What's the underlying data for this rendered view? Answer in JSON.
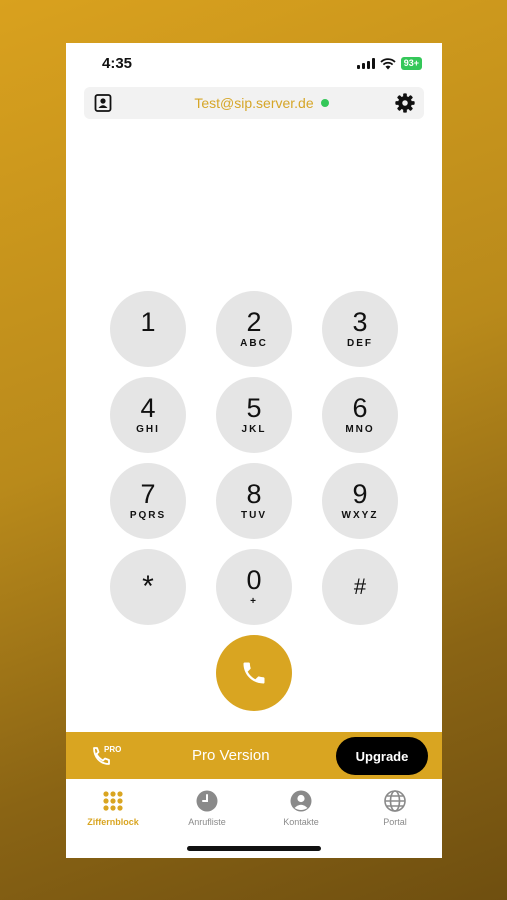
{
  "status_bar": {
    "time": "4:35",
    "battery": "93+"
  },
  "account": {
    "address": "Test@sip.server.de",
    "status_color": "#34c759"
  },
  "keypad": {
    "keys": [
      {
        "digit": "1",
        "letters": ""
      },
      {
        "digit": "2",
        "letters": "ABC"
      },
      {
        "digit": "3",
        "letters": "DEF"
      },
      {
        "digit": "4",
        "letters": "GHI"
      },
      {
        "digit": "5",
        "letters": "JKL"
      },
      {
        "digit": "6",
        "letters": "MNO"
      },
      {
        "digit": "7",
        "letters": "PQRS"
      },
      {
        "digit": "8",
        "letters": "TUV"
      },
      {
        "digit": "9",
        "letters": "WXYZ"
      },
      {
        "digit": "*",
        "letters": ""
      },
      {
        "digit": "0",
        "letters": "+"
      },
      {
        "digit": "#",
        "letters": ""
      }
    ]
  },
  "pro_banner": {
    "label": "Pro Version",
    "badge": "PRO",
    "upgrade_label": "Upgrade"
  },
  "tabs": [
    {
      "label": "Ziffernblock",
      "icon": "keypad-grid-icon",
      "active": true
    },
    {
      "label": "Anrufliste",
      "icon": "clock-icon",
      "active": false
    },
    {
      "label": "Kontakte",
      "icon": "person-icon",
      "active": false
    },
    {
      "label": "Portal",
      "icon": "globe-icon",
      "active": false
    }
  ],
  "colors": {
    "accent": "#d9a521",
    "key_bg": "#e5e5e5",
    "online": "#34c759"
  }
}
